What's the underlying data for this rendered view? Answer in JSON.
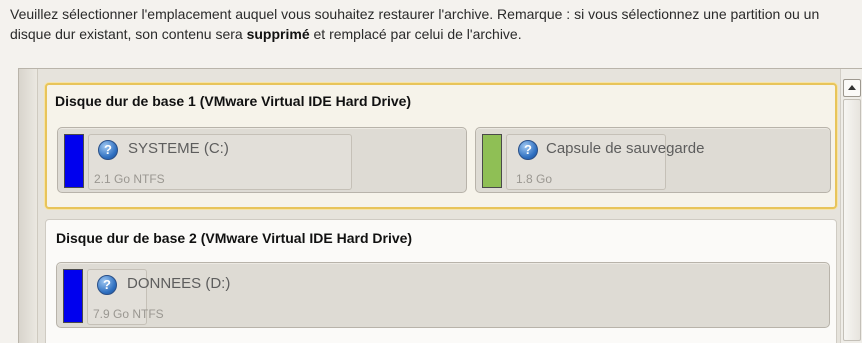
{
  "instructions": {
    "text_before": "Veuillez sélectionner l'emplacement auquel vous souhaitez restaurer l'archive. Remarque : si vous sélectionnez une partition ou un disque dur existant, son contenu sera ",
    "bold": "supprimé",
    "text_after": " et remplacé par celui de l'archive."
  },
  "disks": [
    {
      "title": "Disque dur de base 1 (VMware Virtual IDE Hard Drive)",
      "selected": true,
      "partitions": [
        {
          "name": "SYSTEME (C:)",
          "size": "2.1 Go NTFS",
          "color": "#0000ee",
          "icon": "help-icon"
        },
        {
          "name": "Capsule de sauvegarde",
          "size": "1.8 Go",
          "color": "#8fbf55",
          "icon": "help-icon"
        }
      ]
    },
    {
      "title": "Disque dur de base 2 (VMware Virtual IDE Hard Drive)",
      "selected": false,
      "partitions": [
        {
          "name": "DONNEES (D:)",
          "size": "7.9 Go NTFS",
          "color": "#0000ee",
          "icon": "help-icon"
        }
      ]
    }
  ],
  "help_glyph": "?",
  "colors": {
    "selection_border": "#e8c45a",
    "partition_blue": "#0000ee",
    "capsule_green": "#8fbf55"
  }
}
